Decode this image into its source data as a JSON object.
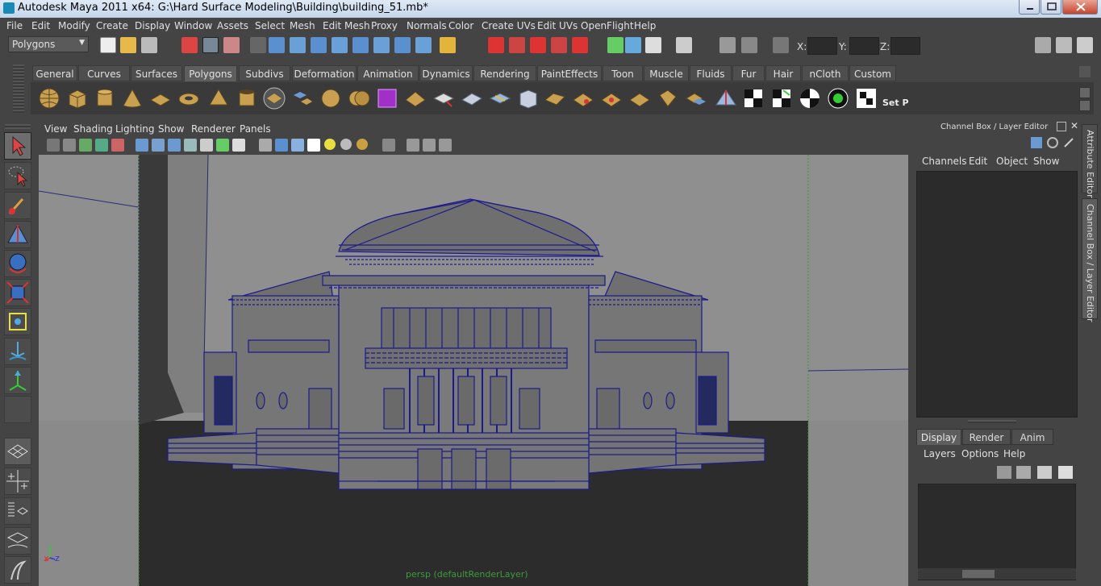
{
  "window": {
    "title": "Autodesk Maya 2011 x64: G:\\Hard Surface Modeling\\Building\\building_51.mb*"
  },
  "menubar": [
    "File",
    "Edit",
    "Modify",
    "Create",
    "Display",
    "Window",
    "Assets",
    "Select",
    "Mesh",
    "Edit Mesh",
    "Proxy",
    "Normals",
    "Color",
    "Create UVs",
    "Edit UVs",
    "OpenFlight",
    "Help"
  ],
  "statusline": {
    "mode": "Polygons",
    "x_label": "X:",
    "y_label": "Y:",
    "z_label": "Z:",
    "x_value": "",
    "y_value": "",
    "z_value": ""
  },
  "shelf": {
    "tabs": [
      "General",
      "Curves",
      "Surfaces",
      "Polygons",
      "Subdivs",
      "Deformation",
      "Animation",
      "Dynamics",
      "Rendering",
      "PaintEffects",
      "Toon",
      "Muscle",
      "Fluids",
      "Fur",
      "Hair",
      "nCloth",
      "Custom"
    ],
    "active_tab": "Polygons",
    "last_icon_label": "Set P"
  },
  "panel": {
    "menus": [
      "View",
      "Shading",
      "Lighting",
      "Show",
      "Renderer",
      "Panels"
    ],
    "camera_label": "persp (defaultRenderLayer)",
    "axis_x": "x",
    "axis_z": "z"
  },
  "channel_box": {
    "title": "Channel Box / Layer Editor",
    "menus": [
      "Channels",
      "Edit",
      "Object",
      "Show"
    ]
  },
  "layer_editor": {
    "tabs": [
      "Display",
      "Render",
      "Anim"
    ],
    "active_tab": "Display",
    "menus": [
      "Layers",
      "Options",
      "Help"
    ]
  },
  "side_tabs": [
    "Attribute Editor",
    "Channel Box / Layer Editor"
  ],
  "colors": {
    "wireframe": "#1c1a8c",
    "viewport_bg": "#8f8f8f",
    "ui_bg": "#444444",
    "accent": "#5e5e5e"
  }
}
